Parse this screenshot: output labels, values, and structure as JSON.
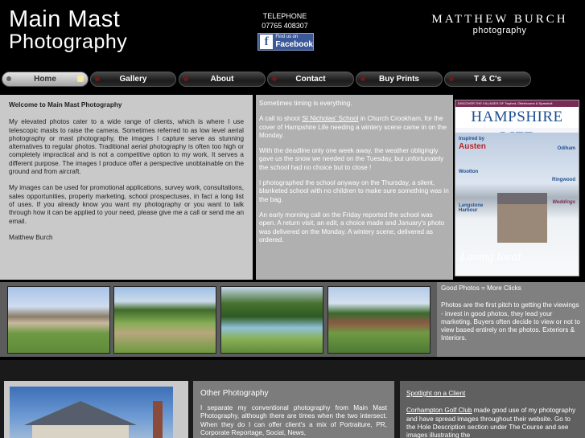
{
  "header": {
    "logo_line1": "Main Mast",
    "logo_line2": "Photography",
    "telephone_label": "TELEPHONE",
    "telephone_number": "07765 408307",
    "facebook_small": "Find us on",
    "facebook_label": "Facebook",
    "brand_name": "MATTHEW BURCH",
    "brand_sub": "photography"
  },
  "nav": [
    {
      "label": "Home"
    },
    {
      "label": "Gallery"
    },
    {
      "label": "About"
    },
    {
      "label": "Contact"
    },
    {
      "label": "Buy Prints"
    },
    {
      "label": "T & C's"
    }
  ],
  "intro": {
    "title": "Welcome to Main Mast Photography",
    "p1": "My elevated photos cater to a wide range of clients, which is where I use telescopic masts to raise the camera.  Sometimes referred to as low level aerial photography or mast photography, the images I capture serve as stunning alternatives to regular photos.  Traditional aerial photography is often too high or completely impractical and is not a competitive option to my work.  It serves a different purpose.  The images I produce offer a perspective unobtainable on the ground and from aircraft.",
    "p2": "My images can be used for promotional applications, survey work, consultations, sales opportunities, property marketing, school prospectuses, in fact a long list of uses.  If you already know you want my photography or you want to talk through how it can be applied to your need, please give me a call or send me an email.",
    "signature": "Matthew Burch"
  },
  "story": {
    "p1": "Sometimes timing is everything.",
    "p2_before": "A call to shoot ",
    "p2_link": "St Nicholas' School",
    "p2_after": " in Church Crookham, for the cover of Hampshire Life needing a wintery scene came in on the Monday.",
    "p3": "With the deadline only one week away, the weather obligingly gave us the snow we needed on the Tuesday, but unfortunately the school had no choice but to close !",
    "p4": "I photographed the school anyway on the Thursday, a silent, blanketed school with no children to make sure something was in the bag.",
    "p5": "An early morning call on the Friday reported the school was open.  A return visit, an edit, a choice made and January's photo was delivered on the Monday.  A wintery scene, delivered as ordered."
  },
  "magazine": {
    "top_strip": "DISCOVER THE VILLAGES OF  Twyford, Otterbourne & Sparsholt",
    "title": "HAMPSHIRE LIFE",
    "inspired": "Inspired by",
    "austen": "Austen",
    "oakham": "Odiham",
    "ringwood": "Ringwood",
    "wootton": "Wootton",
    "weddings": "Weddings",
    "langstone": "Langstone Harbour",
    "loving": "Loving local"
  },
  "colors": {
    "facebook": "#3b5998",
    "magazine_blue": "#1f4f91",
    "intro_bg": "#c9c9c9",
    "story_bg": "#b0b0b0"
  },
  "good_photos": {
    "title": "Good Photos = More Clicks",
    "body": "Photos are the first pitch to getting the viewings - invest in good photos, they lead your marketing. Buyers often decide to view or not to view based entirely on the photos. Exteriors & Interiors."
  },
  "other": {
    "title": "Other Photography",
    "body": "I separate my conventional photography from Main Mast Photography, although there are times when the two intersect.  When they do I can offer client's a mix of Portraiture, PR, Corporate Reportage, Social, News,"
  },
  "spotlight": {
    "title": "Spotlight on a Client",
    "link": "Corhampton Golf Club",
    "body": " made good use of my photography and have spread images throughout their website. Go to the Hole Description section under The Course and see images illustrating the"
  }
}
